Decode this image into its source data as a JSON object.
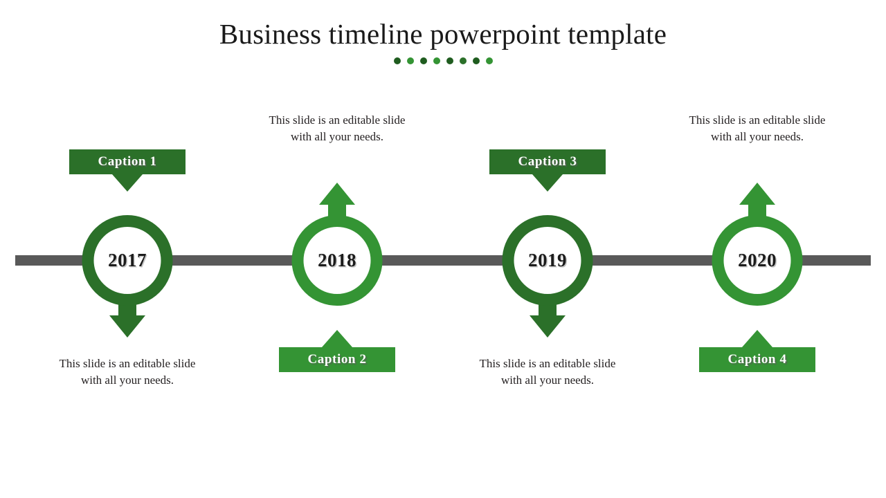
{
  "slide": {
    "title": "Business timeline powerpoint template",
    "background_color": "#ffffff",
    "divider_dots": {
      "count": 8,
      "colors": [
        "#1f5c1f",
        "#349434",
        "#1f5c1f",
        "#349434",
        "#1f5c1f",
        "#2b7029",
        "#1f5c1f",
        "#349434"
      ]
    },
    "timeline_bar_color": "#595959"
  },
  "colors": {
    "green_dark": "#2b7029",
    "green_light": "#349434",
    "bar_gray": "#595959",
    "year_text": "#1c1c1c",
    "body_text": "#231f20",
    "caption_text": "#ffffff"
  },
  "nodes": [
    {
      "year": "2017",
      "ring_color": "#2b7029",
      "arrow_direction": "down",
      "arrow_color": "#2b7029",
      "caption": {
        "label": "Caption  1",
        "position": "above",
        "pointer": "down",
        "color": "#2b7029"
      },
      "description": {
        "text": "This slide is an editable slide with all your needs.",
        "position": "below"
      }
    },
    {
      "year": "2018",
      "ring_color": "#349434",
      "arrow_direction": "up",
      "arrow_color": "#349434",
      "caption": {
        "label": "Caption  2",
        "position": "below",
        "pointer": "up",
        "color": "#349434"
      },
      "description": {
        "text": "This slide is an editable slide with all your needs.",
        "position": "above"
      }
    },
    {
      "year": "2019",
      "ring_color": "#2b7029",
      "arrow_direction": "down",
      "arrow_color": "#2b7029",
      "caption": {
        "label": "Caption  3",
        "position": "above",
        "pointer": "down",
        "color": "#2b7029"
      },
      "description": {
        "text": "This slide is an editable slide with all your needs.",
        "position": "below"
      }
    },
    {
      "year": "2020",
      "ring_color": "#349434",
      "arrow_direction": "up",
      "arrow_color": "#349434",
      "caption": {
        "label": "Caption  4",
        "position": "below",
        "pointer": "up",
        "color": "#349434"
      },
      "description": {
        "text": "This slide is an editable slide with all your needs.",
        "position": "above"
      }
    }
  ]
}
